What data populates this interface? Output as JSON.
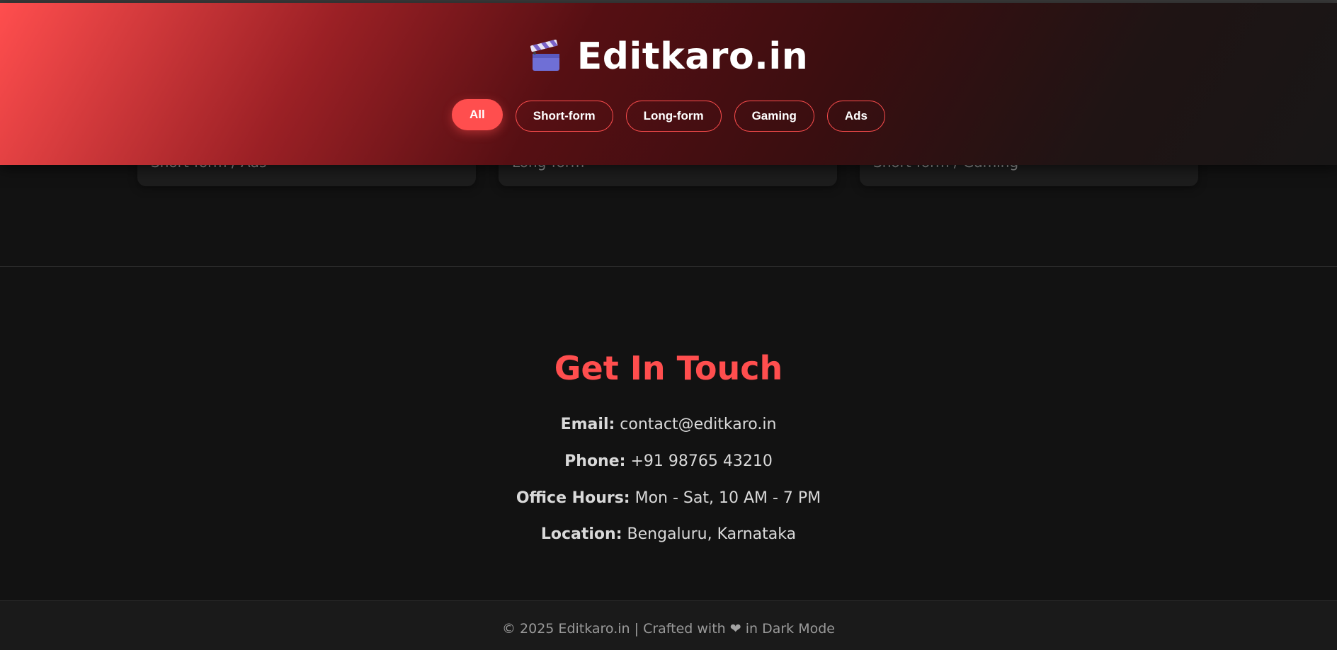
{
  "header": {
    "brand_icon": "clapperboard-icon",
    "title": "Editkaro.in",
    "gradient": [
      "#ff4e4e",
      "#560f13",
      "#181616"
    ]
  },
  "filters": [
    {
      "label": "All",
      "active": true
    },
    {
      "label": "Short-form",
      "active": false
    },
    {
      "label": "Long-form",
      "active": false
    },
    {
      "label": "Gaming",
      "active": false
    },
    {
      "label": "Ads",
      "active": false
    }
  ],
  "cards": [
    {
      "meta": "Short-form / Ads"
    },
    {
      "meta": "Long-form"
    },
    {
      "meta": "Short-form / Gaming"
    }
  ],
  "contact": {
    "title": "Get In Touch",
    "email_label": "Email:",
    "email_value": "contact@editkaro.in",
    "phone_label": "Phone:",
    "phone_value": "+91 98765 43210",
    "hours_label": "Office Hours:",
    "hours_value": "Mon - Sat, 10 AM - 7 PM",
    "location_label": "Location:",
    "location_value": "Bengaluru, Karnataka"
  },
  "footer": {
    "prefix": "© 2025 Editkaro.in | Crafted with",
    "heart_icon": "heart-icon",
    "suffix": "in Dark Mode"
  },
  "colors": {
    "accent": "#ff4e4e",
    "background": "#121212",
    "card": "#1d1d1d",
    "footer": "#1a1a1a"
  }
}
